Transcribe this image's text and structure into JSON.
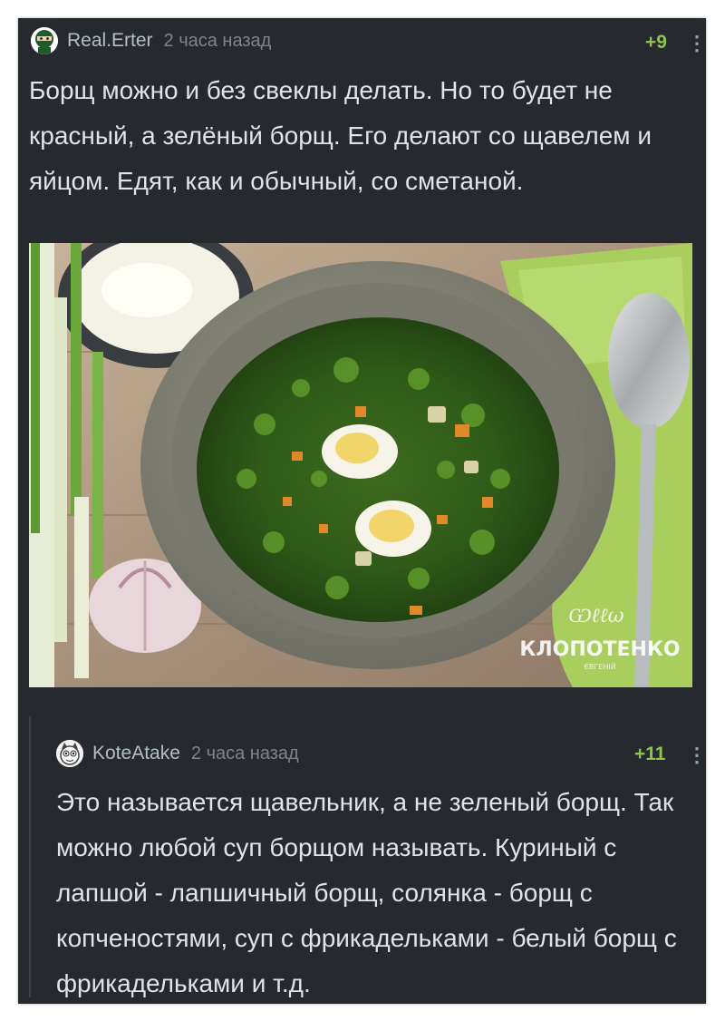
{
  "post_comment": {
    "username": "Real.Erter",
    "time": "2 часа назад",
    "rating": "+9",
    "more_icon": "⋮",
    "text": "Борщ можно и без свеклы делать. Но то будет не красный, а зелёный борщ. Его делают со щавелем и яйцом. Едят, как и обычный, со сметаной.",
    "image": {
      "watermark_signature": "Klopotenko signature",
      "watermark_brand": "КЛОПОТЕНКО",
      "watermark_sub": "ЄВГЕНІЙ"
    }
  },
  "reply_comment": {
    "username": "KoteAtake",
    "time": "2 часа назад",
    "rating": "+11",
    "more_icon": "⋮",
    "text": "Это называется щавельник, а не зеленый борщ. Так можно любой суп борщом называть. Куриный с лапшой - лапшичный борщ, солянка - борщ с копченостями, суп с фрикадельками - белый борщ с фрикадельками и т.д."
  },
  "colors": {
    "background": "#26292e",
    "rating": "#8fc44a",
    "username": "#b3bfc7",
    "text": "#dfe4e8"
  }
}
